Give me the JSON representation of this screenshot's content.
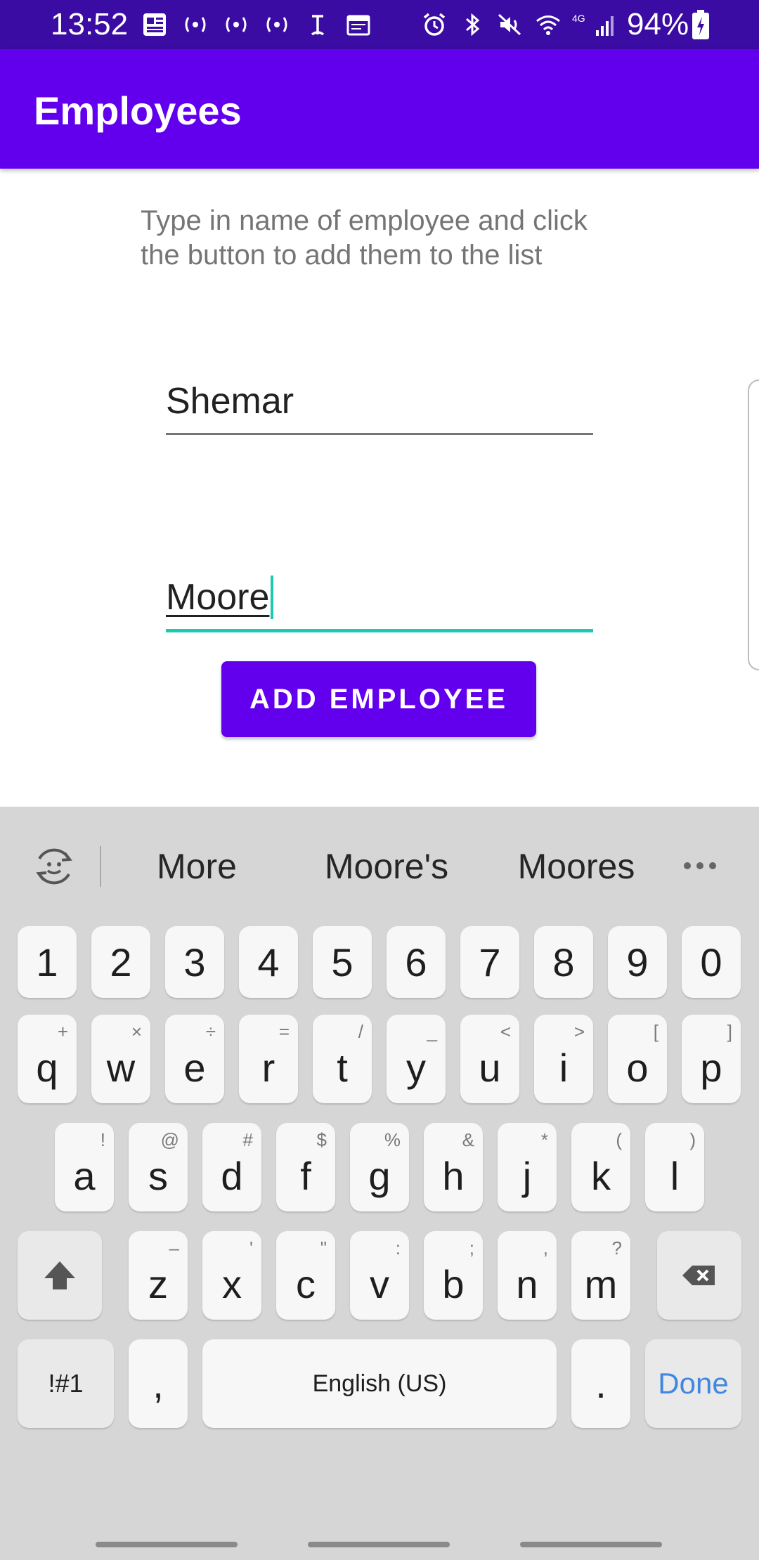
{
  "status_bar": {
    "time": "13:52",
    "battery": "94%",
    "left_icons": [
      "news-icon",
      "cast-icon",
      "cast-icon",
      "cast-icon",
      "nyt-icon",
      "calendar-icon"
    ],
    "right_icons": [
      "alarm-icon",
      "bluetooth-icon",
      "mute-icon",
      "wifi-icon",
      "signal-4g-icon"
    ]
  },
  "app_bar": {
    "title": "Employees"
  },
  "instructions": "Type in name of employee and click the button to add them to the list",
  "form": {
    "first_name": "Shemar",
    "last_name": "Moore",
    "button_label": "ADD EMPLOYEE"
  },
  "keyboard": {
    "suggestions": [
      "More",
      "Moore's",
      "Moores"
    ],
    "number_row": [
      "1",
      "2",
      "3",
      "4",
      "5",
      "6",
      "7",
      "8",
      "9",
      "0"
    ],
    "row1": [
      {
        "key": "q",
        "hint": "+"
      },
      {
        "key": "w",
        "hint": "×"
      },
      {
        "key": "e",
        "hint": "÷"
      },
      {
        "key": "r",
        "hint": "="
      },
      {
        "key": "t",
        "hint": "/"
      },
      {
        "key": "y",
        "hint": "_"
      },
      {
        "key": "u",
        "hint": "<"
      },
      {
        "key": "i",
        "hint": ">"
      },
      {
        "key": "o",
        "hint": "["
      },
      {
        "key": "p",
        "hint": "]"
      }
    ],
    "row2": [
      {
        "key": "a",
        "hint": "!"
      },
      {
        "key": "s",
        "hint": "@"
      },
      {
        "key": "d",
        "hint": "#"
      },
      {
        "key": "f",
        "hint": "$"
      },
      {
        "key": "g",
        "hint": "%"
      },
      {
        "key": "h",
        "hint": "&"
      },
      {
        "key": "j",
        "hint": "*"
      },
      {
        "key": "k",
        "hint": "("
      },
      {
        "key": "l",
        "hint": ")"
      }
    ],
    "row3": [
      {
        "key": "z",
        "hint": "–"
      },
      {
        "key": "x",
        "hint": "'"
      },
      {
        "key": "c",
        "hint": "\""
      },
      {
        "key": "v",
        "hint": ":"
      },
      {
        "key": "b",
        "hint": ";"
      },
      {
        "key": "n",
        "hint": ","
      },
      {
        "key": "m",
        "hint": "?"
      }
    ],
    "symbols_label": "!#1",
    "comma_label": ",",
    "space_label": "English (US)",
    "period_label": ".",
    "done_label": "Done",
    "shift_icon": "shift-icon",
    "backspace_icon": "backspace-icon"
  },
  "colors": {
    "status_bar": "#3a0ca3",
    "primary": "#6200ee",
    "accent": "#1ec8b4",
    "keyboard_bg": "#d6d6d6",
    "done_blue": "#3f87e0"
  }
}
